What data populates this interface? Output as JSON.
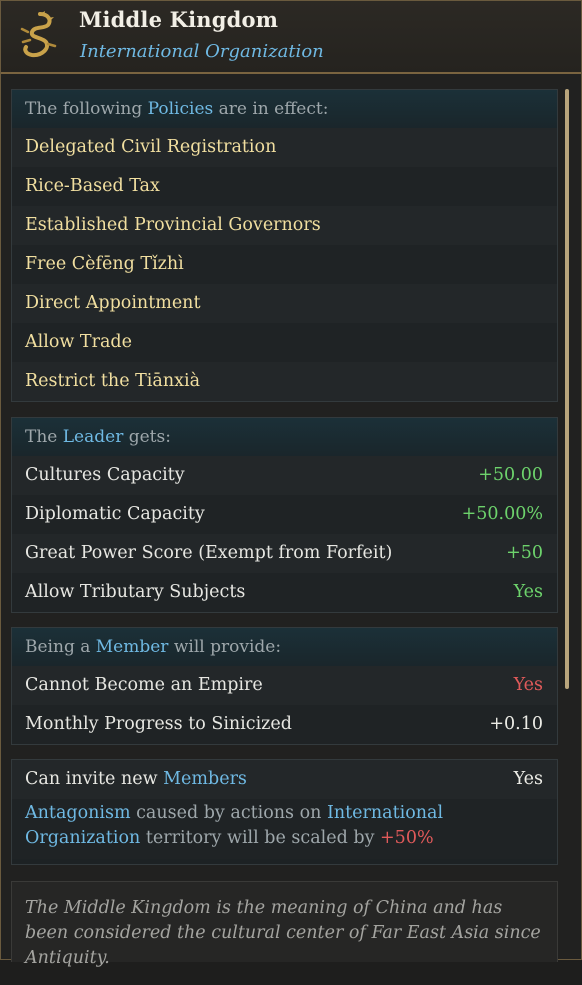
{
  "header": {
    "icon": "dragon-emblem-icon",
    "title": "Middle Kingdom",
    "subtitle": "International Organization"
  },
  "policies": {
    "head_pre": "The following ",
    "head_hl": "Policies",
    "head_post": " are in effect:",
    "items": [
      "Delegated Civil Registration",
      "Rice-Based Tax",
      "Established Provincial Governors",
      "Free Cèfēng Tǐzhì",
      "Direct Appointment",
      "Allow Trade",
      "Restrict the Tiānxià"
    ]
  },
  "leader": {
    "head_pre": "The ",
    "head_hl": "Leader",
    "head_post": " gets:",
    "rows": [
      {
        "label": "Cultures Capacity",
        "value": "+50.00"
      },
      {
        "label": "Diplomatic Capacity",
        "value": "+50.00%"
      },
      {
        "label": "Great Power Score (Exempt from Forfeit)",
        "value": "+50"
      },
      {
        "label": "Allow Tributary Subjects",
        "value": "Yes"
      }
    ]
  },
  "member": {
    "head_pre": "Being a ",
    "head_hl": "Member",
    "head_post": " will provide:",
    "rows": [
      {
        "label": "Cannot Become an Empire",
        "value": "Yes"
      },
      {
        "label": "Monthly Progress to Sinicized",
        "value": "+0.10"
      }
    ]
  },
  "invite": {
    "label_pre": "Can invite new ",
    "label_hl": "Members",
    "value": "Yes",
    "antagonism_hl": "Antagonism",
    "antagonism_mid": " caused by actions on ",
    "antagonism_hl2": "International Organization",
    "antagonism_post": " territory will be scaled by ",
    "antagonism_value": "+50%"
  },
  "flavor": "The Middle Kingdom is the meaning of China and has been considered the cultural center of Far East Asia since Antiquity.",
  "colors": {
    "accent_blue": "#6fb9e3",
    "policy_gold": "#f1dfa0",
    "positive_green": "#6dd36c",
    "negative_red": "#e05a5a"
  }
}
